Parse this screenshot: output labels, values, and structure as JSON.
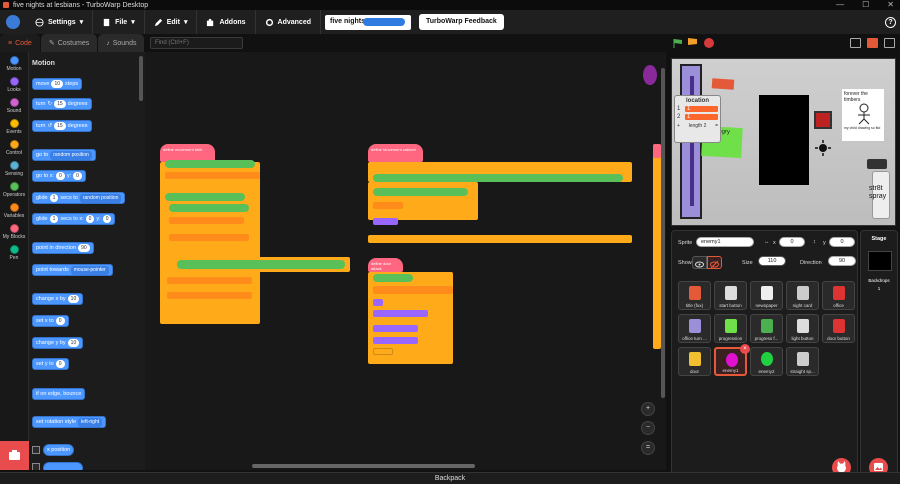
{
  "window": {
    "title": "five nights at lesbians - TurboWarp Desktop",
    "controls": [
      "—",
      "☐",
      "✕"
    ]
  },
  "menu": {
    "settings": "Settings",
    "file": "File",
    "edit": "Edit",
    "addons": "Addons",
    "advanced": "Advanced",
    "project_title": "five nights a",
    "feedback": "TurboWarp Feedback",
    "help": "?"
  },
  "tabs": {
    "code": "Code",
    "costumes": "Costumes",
    "sounds": "Sounds"
  },
  "search": {
    "placeholder": "Find (Ctrl+F)"
  },
  "categories": [
    {
      "label": "Motion",
      "color": "#4c97ff"
    },
    {
      "label": "Looks",
      "color": "#9966ff"
    },
    {
      "label": "Sound",
      "color": "#cf63cf"
    },
    {
      "label": "Events",
      "color": "#ffbf00"
    },
    {
      "label": "Control",
      "color": "#ffab19"
    },
    {
      "label": "Sensing",
      "color": "#5cb1d6"
    },
    {
      "label": "Operators",
      "color": "#59c059"
    },
    {
      "label": "Variables",
      "color": "#ff8c1a"
    },
    {
      "label": "My Blocks",
      "color": "#ff6680"
    },
    {
      "label": "Pen",
      "color": "#0fbd8c"
    }
  ],
  "palette": {
    "title": "Motion",
    "move": {
      "a": "move",
      "n": "10",
      "b": "steps"
    },
    "turn_right": {
      "a": "turn",
      "n": "15",
      "b": "degrees"
    },
    "turn_left": {
      "a": "turn",
      "n": "15",
      "b": "degrees"
    },
    "goto": {
      "a": "go to",
      "dd": "random position"
    },
    "gotoxy": {
      "a": "go to x:",
      "x": "0",
      "b": "y:",
      "y": "0"
    },
    "glide_to": {
      "a": "glide",
      "n": "1",
      "b": "secs to",
      "dd": "random position"
    },
    "glide_xy": {
      "a": "glide",
      "n": "1",
      "b": "secs to x:",
      "x": "0",
      "c": "y:",
      "y": "0"
    },
    "point_dir": {
      "a": "point in direction",
      "n": "90"
    },
    "point_towards": {
      "a": "point towards",
      "dd": "mouse-pointer"
    },
    "change_x": {
      "a": "change x by",
      "n": "10"
    },
    "set_x": {
      "a": "set x to",
      "n": "0"
    },
    "change_y": {
      "a": "change y by",
      "n": "10"
    },
    "set_y": {
      "a": "set y to",
      "n": "0"
    },
    "bounce": "if on edge, bounce",
    "rotation": {
      "a": "set rotation style",
      "dd": "left-right"
    },
    "xpos": "x position"
  },
  "code": {
    "script1_hat": "define  movement bleh",
    "script2_hat": "define  Movement  cabinet",
    "script3_hat": "define  door attack"
  },
  "zoom": {
    "in": "+",
    "out": "−",
    "reset": "="
  },
  "backpack": "Backpack",
  "stage": {
    "monitor_title": "location",
    "monitor_rows": [
      {
        "i": "1",
        "v": "1"
      },
      {
        "i": "2",
        "v": "1"
      }
    ],
    "monitor_footer_plus": "+",
    "monitor_footer": "length 2",
    "monitor_footer_eq": "=",
    "poster_text": "forever the timbers",
    "poster_sub": "my child drawing so fkd",
    "green_note": "ur hungry mgmt",
    "spray_label": "str8t spray"
  },
  "sprite_info": {
    "sprite_label": "Sprite",
    "sprite_name": "enemy1",
    "x_label": "x",
    "x_value": "0",
    "y_label": "y",
    "y_value": "0",
    "show_label": "Show",
    "size_label": "Size",
    "size_value": "110",
    "direction_label": "Direction",
    "direction_value": "90"
  },
  "sprites": [
    {
      "name": "title (fux)"
    },
    {
      "name": "start button"
    },
    {
      "name": "newspaper"
    },
    {
      "name": "night card"
    },
    {
      "name": "office"
    },
    {
      "name": "office turn ..."
    },
    {
      "name": "progression"
    },
    {
      "name": "progress f..."
    },
    {
      "name": "light button"
    },
    {
      "name": "door button"
    },
    {
      "name": "door"
    },
    {
      "name": "enemy1"
    },
    {
      "name": "enemy2"
    },
    {
      "name": "straight sp..."
    }
  ],
  "stage_panel": {
    "title": "Stage",
    "backdrops_label": "Backdrops",
    "backdrops_count": "1"
  }
}
